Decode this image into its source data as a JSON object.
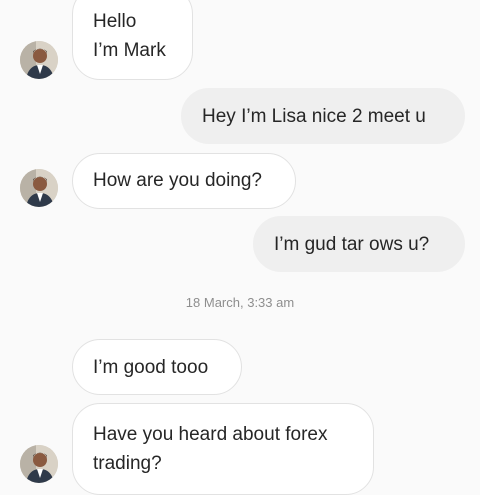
{
  "messages": [
    {
      "sender": "Mark",
      "lines": [
        "Hello",
        "I’m Mark"
      ]
    },
    {
      "sender": "Lisa",
      "lines": [
        "Hey I’m Lisa nice 2 meet u"
      ]
    },
    {
      "sender": "Mark",
      "lines": [
        "How are you doing?"
      ]
    },
    {
      "sender": "Lisa",
      "lines": [
        "I’m gud tar ows u?"
      ]
    },
    {
      "sender": "Mark",
      "lines": [
        "I’m good tooo"
      ]
    },
    {
      "sender": "Mark",
      "lines": [
        "Have you heard about forex",
        "trading?"
      ]
    }
  ],
  "timestamp": "18 March, 3:33 am",
  "avatar_icon": "profile-photo-man-in-suit"
}
